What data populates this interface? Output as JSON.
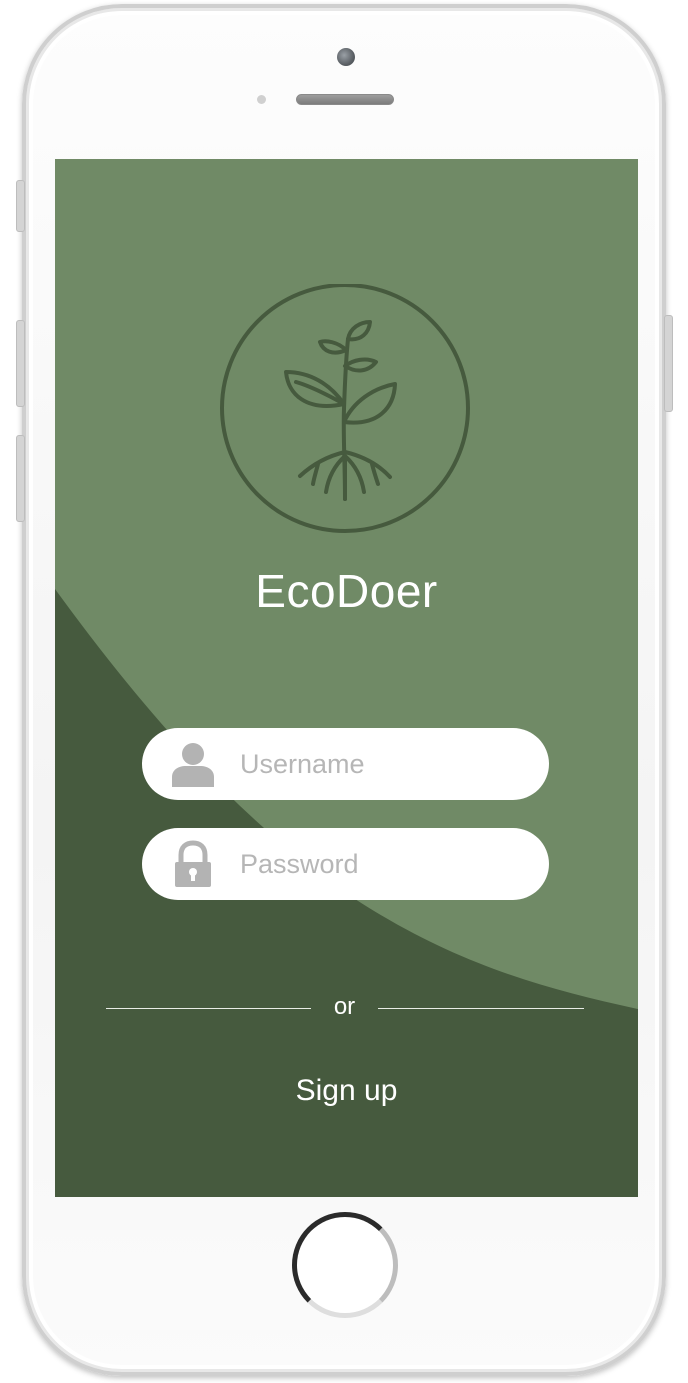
{
  "app": {
    "name": "EcoDoer"
  },
  "login": {
    "username_placeholder": "Username",
    "password_placeholder": "Password",
    "divider_text": "or",
    "signup_label": "Sign up"
  },
  "icons": {
    "logo": "plant-sprout-icon",
    "username": "user-icon",
    "password": "lock-icon"
  },
  "colors": {
    "screen_light_green": "#708a66",
    "screen_dark_green": "#465a3e",
    "text_white": "#ffffff",
    "field_background": "#ffffff",
    "placeholder_gray": "#b6b6b6",
    "icon_gray": "#b3b3b3"
  }
}
